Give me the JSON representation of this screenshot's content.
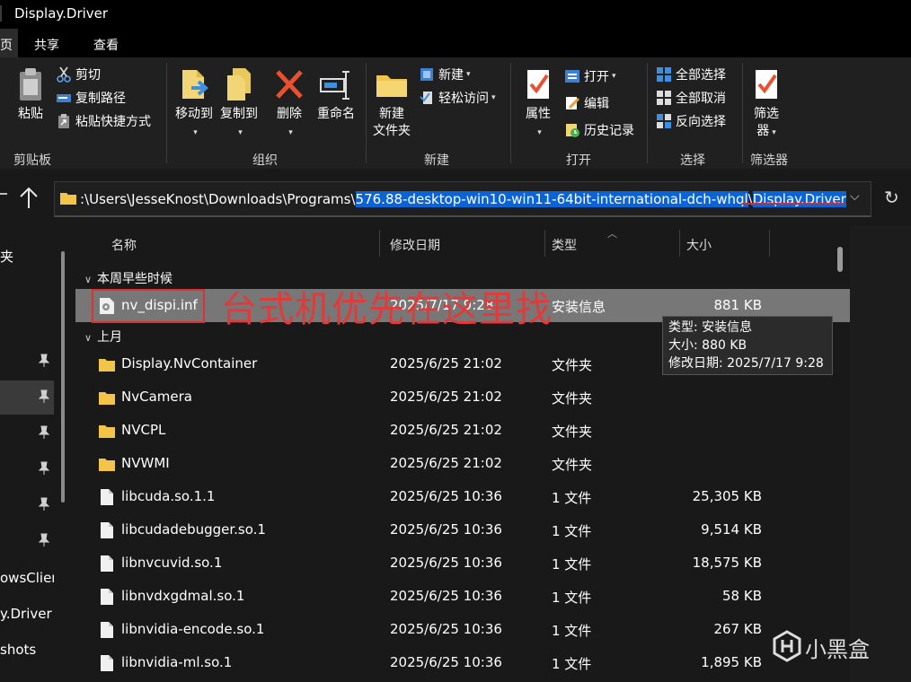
{
  "window": {
    "title": "Display.Driver"
  },
  "ribbon_tabs": [
    {
      "label": "页"
    },
    {
      "label": "共享"
    },
    {
      "label": "查看"
    }
  ],
  "ribbon": {
    "clipboard": {
      "paste": "粘贴",
      "cut": "剪切",
      "copy_path": "复制路径",
      "paste_shortcut": "粘贴快捷方式",
      "group_label": "剪贴板"
    },
    "organize": {
      "move_to": "移动到",
      "copy_to": "复制到",
      "delete": "删除",
      "rename": "重命名",
      "group_label": "组织"
    },
    "new": {
      "new_folder_line1": "新建",
      "new_folder_line2": "文件夹",
      "new_item": "新建",
      "easy_access": "轻松访问",
      "group_label": "新建"
    },
    "open": {
      "properties": "属性",
      "open": "打开",
      "edit": "编辑",
      "history": "历史记录",
      "group_label": "打开"
    },
    "select": {
      "select_all": "全部选择",
      "select_none": "全部取消",
      "invert": "反向选择",
      "group_label": "选择"
    },
    "filter": {
      "filter_line1": "筛选",
      "filter_line2": "器",
      "group_label": "筛选器"
    }
  },
  "address": {
    "path_plain": ":\\Users\\JesseKnost\\Downloads\\Programs\\",
    "path_selected_1": "576.88-desktop-win10-win11-64bit-international-dch-whql",
    "path_sep": "\\",
    "path_selected_2": "Display.Driver"
  },
  "nav": {
    "items": [
      {
        "label": "夹"
      },
      {
        "label": "owsClient"
      },
      {
        "label": "y.Driver"
      },
      {
        "label": "shots"
      }
    ]
  },
  "columns": {
    "name": "名称",
    "date": "修改日期",
    "type": "类型",
    "size": "大小"
  },
  "groups": {
    "this_week": "本周早些时候",
    "last_month": "上月"
  },
  "files": [
    {
      "name": "nv_dispi.inf",
      "date": "2025/7/17 9:28",
      "type": "安装信息",
      "size": "881 KB",
      "kind": "inf"
    },
    {
      "name": "Display.NvContainer",
      "date": "2025/6/25 21:02",
      "type": "文件夹",
      "size": "",
      "kind": "folder"
    },
    {
      "name": "NvCamera",
      "date": "2025/6/25 21:02",
      "type": "文件夹",
      "size": "",
      "kind": "folder"
    },
    {
      "name": "NVCPL",
      "date": "2025/6/25 21:02",
      "type": "文件夹",
      "size": "",
      "kind": "folder"
    },
    {
      "name": "NVWMI",
      "date": "2025/6/25 21:02",
      "type": "文件夹",
      "size": "",
      "kind": "folder"
    },
    {
      "name": "libcuda.so.1.1",
      "date": "2025/6/25 10:36",
      "type": "1 文件",
      "size": "25,305 KB",
      "kind": "file"
    },
    {
      "name": "libcudadebugger.so.1",
      "date": "2025/6/25 10:36",
      "type": "1 文件",
      "size": "9,514 KB",
      "kind": "file"
    },
    {
      "name": "libnvcuvid.so.1",
      "date": "2025/6/25 10:36",
      "type": "1 文件",
      "size": "18,575 KB",
      "kind": "file"
    },
    {
      "name": "libnvdxgdmal.so.1",
      "date": "2025/6/25 10:36",
      "type": "1 文件",
      "size": "58 KB",
      "kind": "file"
    },
    {
      "name": "libnvidia-encode.so.1",
      "date": "2025/6/25 10:36",
      "type": "1 文件",
      "size": "267 KB",
      "kind": "file"
    },
    {
      "name": "libnvidia-ml.so.1",
      "date": "2025/6/25 10:36",
      "type": "1 文件",
      "size": "1,895 KB",
      "kind": "file"
    }
  ],
  "annotation": {
    "text": "台式机优先在这里找"
  },
  "tooltip": {
    "type_line": "类型: 安装信息",
    "size_line": "大小: 880 KB",
    "date_line": "修改日期: 2025/7/17 9:28"
  },
  "watermark": {
    "text": "小黑盒"
  },
  "colors": {
    "accent": "#0a64d6",
    "annotation_red": "#e03030",
    "folder_yellow": "#f2c447",
    "selected_row": "#777777"
  }
}
